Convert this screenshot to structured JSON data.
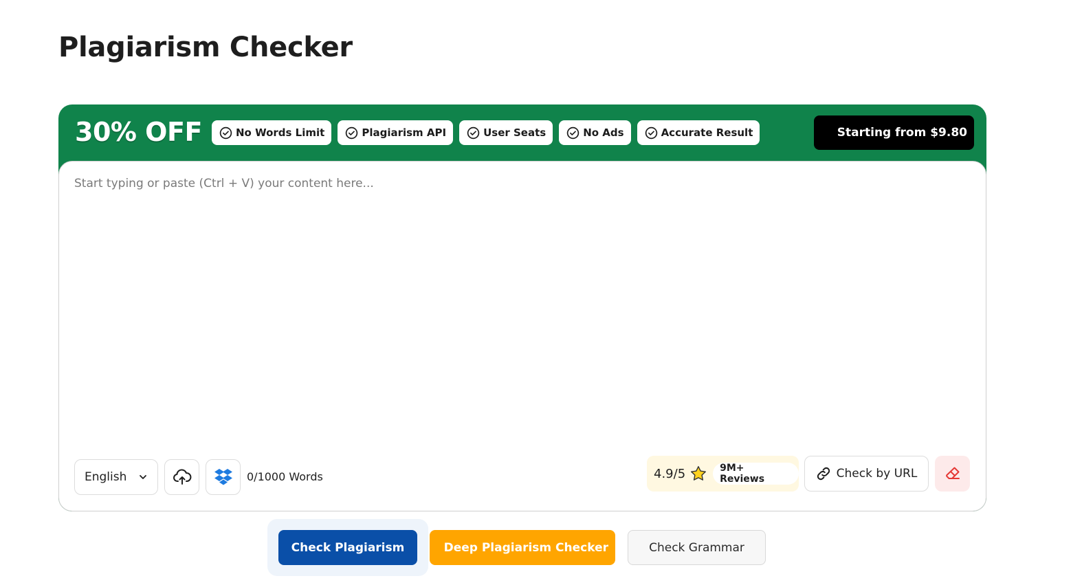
{
  "page": {
    "title": "Plagiarism Checker"
  },
  "promo": {
    "discount": "30% OFF",
    "features": [
      "No Words Limit",
      "Plagiarism API",
      "User Seats",
      "No Ads",
      "Accurate Result"
    ],
    "price_label": "Starting from $9.80",
    "icon": "check-circle-icon"
  },
  "editor": {
    "placeholder": "Start typing or paste (Ctrl + V) your content here...",
    "value": ""
  },
  "toolbar": {
    "language": "English",
    "word_count": "0/1000 Words",
    "rating_score": "4.9/5",
    "reviews": "9M+ Reviews",
    "check_url_label": "Check by URL"
  },
  "actions": {
    "check_plagiarism": "Check Plagiarism",
    "deep_checker": "Deep Plagiarism Checker",
    "check_grammar": "Check Grammar"
  },
  "colors": {
    "brand_green": "#10834b",
    "primary_blue": "#0a4fa8",
    "deep_orange": "#ffa500",
    "clear_red": "#e53935"
  }
}
